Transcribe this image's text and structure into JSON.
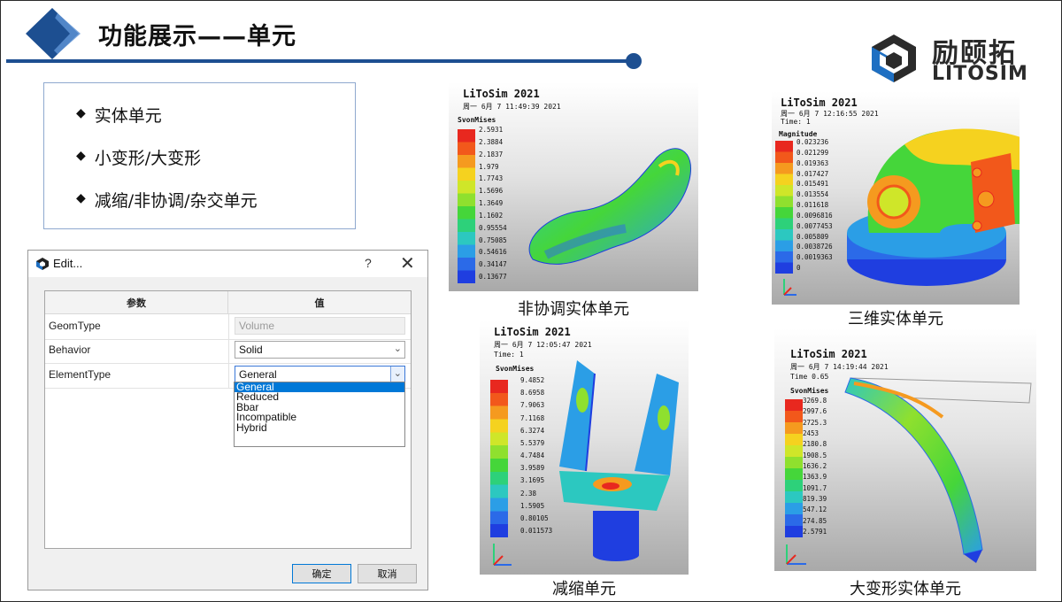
{
  "header": {
    "title": "功能展示——单元",
    "logo_cn": "励颐拓",
    "logo_en": "LITOSIM",
    "accent": "#1d4f91"
  },
  "bullets": [
    "实体单元",
    "小变形/大变形",
    "减缩/非协调/杂交单元"
  ],
  "dialog": {
    "title": "Edit...",
    "help": "?",
    "close": "✕",
    "col_param": "参数",
    "col_value": "值",
    "rows": [
      {
        "label": "GeomType",
        "value": "Volume"
      },
      {
        "label": "Behavior",
        "value": "Solid"
      },
      {
        "label": "ElementType",
        "value": "General"
      }
    ],
    "dropdown_options": [
      "General",
      "Reduced",
      "Bbar",
      "Incompatible",
      "Hybrid"
    ],
    "selected_option": "General",
    "ok": "确定",
    "cancel": "取消"
  },
  "panels": [
    {
      "title": "LiToSim 2021",
      "date": "周一 6月 7 11:49:39 2021",
      "time": "",
      "variable": "SvonMises",
      "ticks": [
        "2.5931",
        "2.3884",
        "2.1837",
        "1.979",
        "1.7743",
        "1.5696",
        "1.3649",
        "1.1602",
        "0.95554",
        "0.75085",
        "0.54616",
        "0.34147",
        "0.13677"
      ],
      "caption": "非协调实体单元"
    },
    {
      "title": "LiToSim 2021",
      "date": "周一 6月 7 12:16:55 2021",
      "time": "Time: 1",
      "variable": "Magnitude",
      "ticks": [
        "0.023236",
        "0.021299",
        "0.019363",
        "0.017427",
        "0.015491",
        "0.013554",
        "0.011618",
        "0.0096816",
        "0.0077453",
        "0.005809",
        "0.0038726",
        "0.0019363",
        "0"
      ],
      "caption": "三维实体单元"
    },
    {
      "title": "LiToSim 2021",
      "date": "周一 6月 7 12:05:47 2021",
      "time": "Time: 1",
      "variable": "SvonMises",
      "ticks": [
        "9.4852",
        "8.6958",
        "7.9063",
        "7.1168",
        "6.3274",
        "5.5379",
        "4.7484",
        "3.9589",
        "3.1695",
        "2.38",
        "1.5905",
        "0.80105",
        "0.011573"
      ],
      "caption": "减缩单元"
    },
    {
      "title": "LiToSim 2021",
      "date": "周一 6月 7 14:19:44 2021",
      "time": "Time   0.65",
      "variable": "SvonMises",
      "ticks": [
        "3269.8",
        "2997.6",
        "2725.3",
        "2453",
        "2180.8",
        "1908.5",
        "1636.2",
        "1363.9",
        "1091.7",
        "819.39",
        "547.12",
        "274.85",
        "2.5791"
      ],
      "caption": "大变形实体单元"
    }
  ],
  "colormap": [
    "#e8281f",
    "#f2581b",
    "#f59a1f",
    "#f5d21f",
    "#cfe629",
    "#8fe02e",
    "#45d63a",
    "#2dd17a",
    "#2cc8c0",
    "#2b9ee6",
    "#2b6ae8",
    "#1f3ee0"
  ]
}
